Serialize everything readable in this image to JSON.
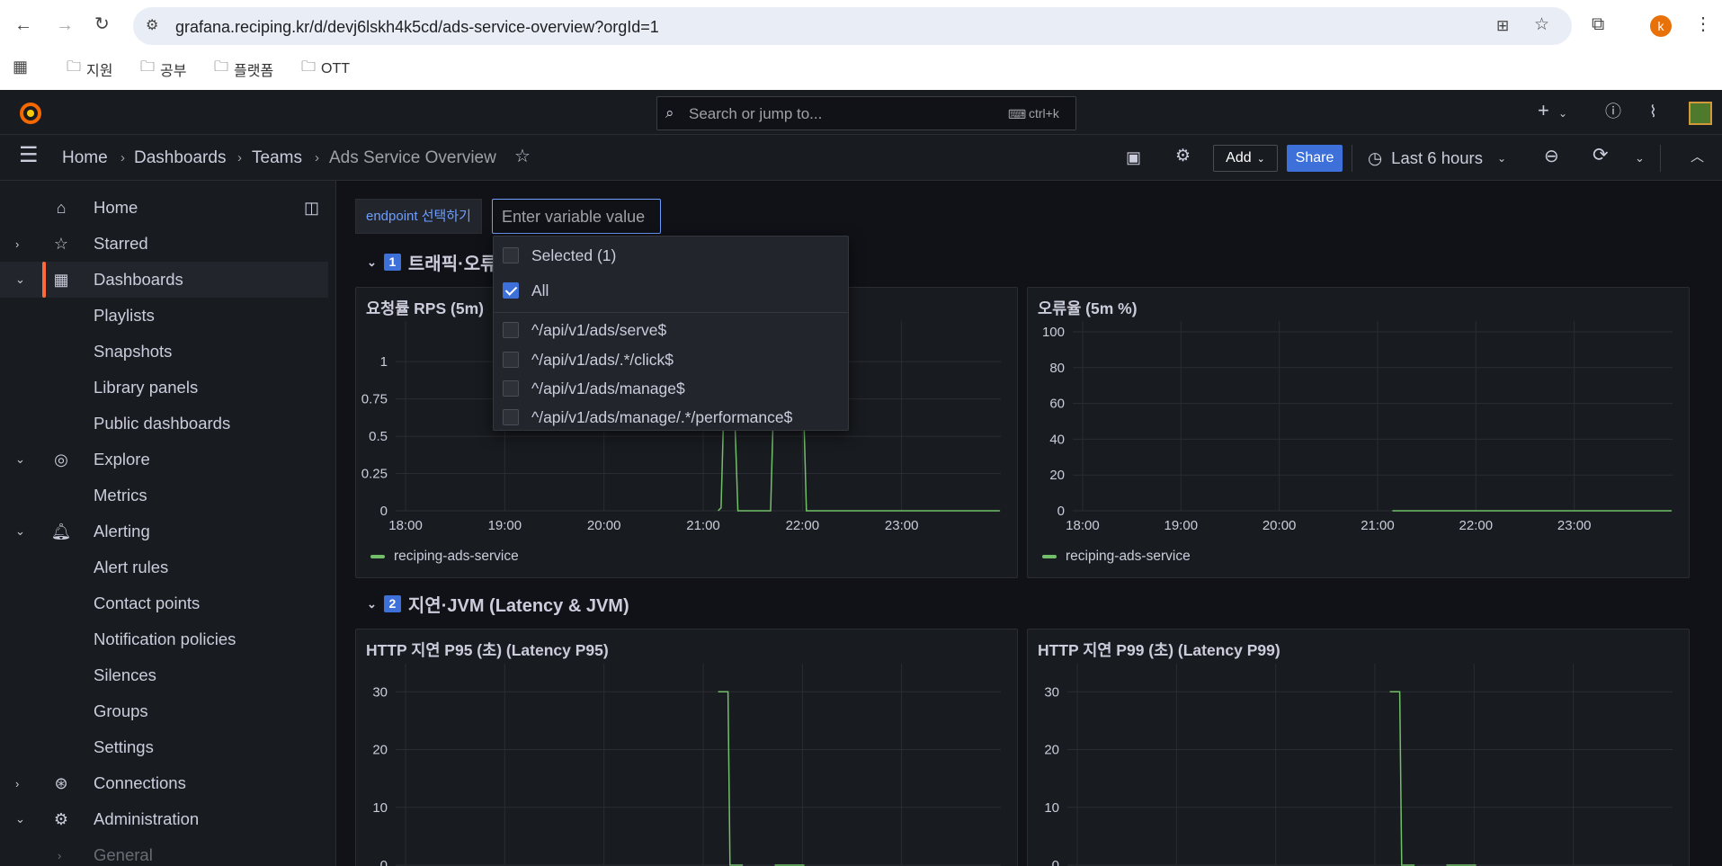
{
  "browser": {
    "url": "grafana.reciping.kr/d/devj6lskh4k5cd/ads-service-overview?orgId=1",
    "profile_initial": "k",
    "bookmarks": [
      "지원",
      "공부",
      "플랫폼",
      "OTT"
    ]
  },
  "topbar": {
    "search_placeholder": "Search or jump to...",
    "shortcut": "ctrl+k"
  },
  "breadcrumb": {
    "items": [
      "Home",
      "Dashboards",
      "Teams"
    ],
    "current": "Ads Service Overview"
  },
  "toolbar": {
    "add_label": "Add",
    "share_label": "Share",
    "time_range": "Last 6 hours"
  },
  "sidebar": {
    "items": [
      {
        "label": "Home",
        "icon": "home-icon"
      },
      {
        "label": "Starred",
        "icon": "star-icon"
      },
      {
        "label": "Dashboards",
        "icon": "dashboards-grid-icon"
      },
      {
        "label": "Playlists"
      },
      {
        "label": "Snapshots"
      },
      {
        "label": "Library panels"
      },
      {
        "label": "Public dashboards"
      },
      {
        "label": "Explore",
        "icon": "compass-icon"
      },
      {
        "label": "Metrics"
      },
      {
        "label": "Alerting",
        "icon": "bell-icon"
      },
      {
        "label": "Alert rules"
      },
      {
        "label": "Contact points"
      },
      {
        "label": "Notification policies"
      },
      {
        "label": "Silences"
      },
      {
        "label": "Groups"
      },
      {
        "label": "Settings"
      },
      {
        "label": "Connections",
        "icon": "connections-icon"
      },
      {
        "label": "Administration",
        "icon": "gear-icon"
      },
      {
        "label": "General"
      }
    ]
  },
  "variable": {
    "label": "endpoint 선택하기",
    "placeholder": "Enter variable value",
    "options_header": "Selected (1)",
    "all_label": "All",
    "all_checked": true,
    "options": [
      "^/api/v1/ads/serve$",
      "^/api/v1/ads/.*/click$",
      "^/api/v1/ads/manage$",
      "^/api/v1/ads/manage/.*/performance$"
    ]
  },
  "rows": [
    {
      "num": "1",
      "title": "트래픽·오류"
    },
    {
      "num": "2",
      "title": "지연·JVM (Latency & JVM)"
    }
  ],
  "panels": {
    "rps": {
      "title": "요청률 RPS (5m)",
      "legend": "reciping-ads-service"
    },
    "errors": {
      "title": "오류율 (5m %)",
      "legend": "reciping-ads-service"
    },
    "p95": {
      "title": "HTTP 지연 P95 (초) (Latency P95)"
    },
    "p99": {
      "title": "HTTP 지연 P99 (초) (Latency P99)"
    }
  },
  "colors": {
    "series": "#73bf69",
    "accent": "#ff6a38",
    "primary": "#3d71d9"
  },
  "chart_data": [
    {
      "type": "line",
      "title": "요청률 RPS (5m)",
      "x": [
        "18:00",
        "19:00",
        "20:00",
        "21:00",
        "22:00",
        "23:00"
      ],
      "ylim": [
        0,
        1.2
      ],
      "yticks": [
        "0",
        "0.25",
        "0.5",
        "0.75",
        "1"
      ],
      "series": [
        {
          "name": "reciping-ads-service",
          "points": [
            [
              21.15,
              0
            ],
            [
              21.18,
              0.02
            ],
            [
              21.22,
              1.0
            ],
            [
              21.3,
              1.0
            ],
            [
              21.35,
              0
            ],
            [
              21.68,
              0
            ],
            [
              21.72,
              1.0
            ],
            [
              22.0,
              1.0
            ],
            [
              22.04,
              0
            ],
            [
              23.99,
              0
            ]
          ]
        }
      ]
    },
    {
      "type": "line",
      "title": "오류율 (5m %)",
      "x": [
        "18:00",
        "19:00",
        "20:00",
        "21:00",
        "22:00",
        "23:00"
      ],
      "ylim": [
        0,
        100
      ],
      "yticks": [
        "0",
        "20",
        "40",
        "60",
        "80",
        "100"
      ],
      "series": [
        {
          "name": "reciping-ads-service",
          "points": [
            [
              21.15,
              0
            ],
            [
              23.99,
              0
            ]
          ]
        }
      ]
    },
    {
      "type": "line",
      "title": "HTTP 지연 P95 (초) (Latency P95)",
      "ylim": [
        0,
        33
      ],
      "yticks": [
        "0",
        "10",
        "20",
        "30"
      ],
      "series": [
        {
          "points": [
            [
              21.15,
              30
            ],
            [
              21.25,
              30
            ],
            [
              21.27,
              0
            ],
            [
              21.4,
              0
            ]
          ],
          "points2": [
            [
              21.72,
              0
            ],
            [
              22.02,
              0
            ]
          ]
        }
      ]
    },
    {
      "type": "line",
      "title": "HTTP 지연 P99 (초) (Latency P99)",
      "ylim": [
        0,
        33
      ],
      "yticks": [
        "0",
        "10",
        "20",
        "30"
      ],
      "series": [
        {
          "points": [
            [
              21.15,
              30
            ],
            [
              21.25,
              30
            ],
            [
              21.27,
              0
            ],
            [
              21.4,
              0
            ]
          ],
          "points2": [
            [
              21.72,
              0
            ],
            [
              22.02,
              0
            ]
          ]
        }
      ]
    }
  ]
}
